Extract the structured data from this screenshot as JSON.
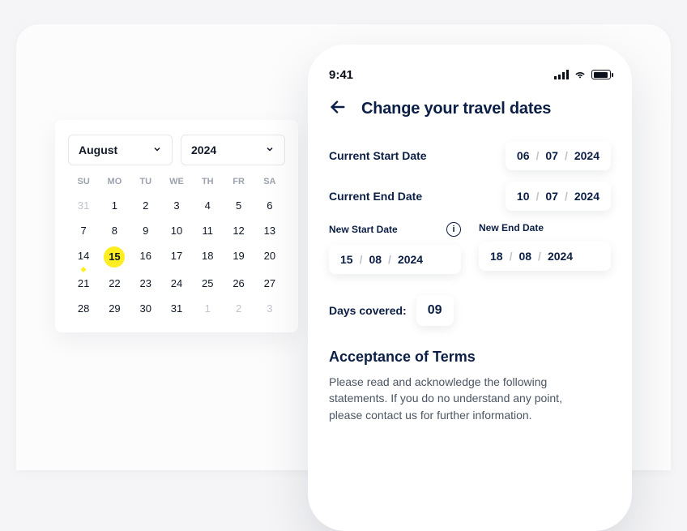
{
  "calendar": {
    "month": "August",
    "year": "2024",
    "weekdays": [
      "SU",
      "MO",
      "TU",
      "WE",
      "TH",
      "FR",
      "SA"
    ],
    "cells": [
      {
        "n": "31",
        "mute": true
      },
      {
        "n": "1"
      },
      {
        "n": "2"
      },
      {
        "n": "3"
      },
      {
        "n": "4"
      },
      {
        "n": "5"
      },
      {
        "n": "6"
      },
      {
        "n": "7"
      },
      {
        "n": "8"
      },
      {
        "n": "9"
      },
      {
        "n": "10"
      },
      {
        "n": "11"
      },
      {
        "n": "12"
      },
      {
        "n": "13"
      },
      {
        "n": "14",
        "dot": true
      },
      {
        "n": "15",
        "sel": true
      },
      {
        "n": "16"
      },
      {
        "n": "17"
      },
      {
        "n": "18"
      },
      {
        "n": "19"
      },
      {
        "n": "20"
      },
      {
        "n": "21"
      },
      {
        "n": "22"
      },
      {
        "n": "23"
      },
      {
        "n": "24"
      },
      {
        "n": "25"
      },
      {
        "n": "26"
      },
      {
        "n": "27"
      },
      {
        "n": "28"
      },
      {
        "n": "29"
      },
      {
        "n": "30"
      },
      {
        "n": "31"
      },
      {
        "n": "1",
        "mute": true
      },
      {
        "n": "2",
        "mute": true
      },
      {
        "n": "3",
        "mute": true
      }
    ]
  },
  "phone": {
    "status": {
      "time": "9:41"
    },
    "header": {
      "title": "Change your travel dates"
    },
    "fields": {
      "current_start": {
        "label": "Current Start Date",
        "dd": "06",
        "mm": "07",
        "yyyy": "2024"
      },
      "current_end": {
        "label": "Current End Date",
        "dd": "10",
        "mm": "07",
        "yyyy": "2024"
      },
      "new_start": {
        "label": "New Start Date",
        "dd": "15",
        "mm": "08",
        "yyyy": "2024"
      },
      "new_end": {
        "label": "New End Date",
        "dd": "18",
        "mm": "08",
        "yyyy": "2024"
      }
    },
    "days_covered": {
      "label": "Days covered:",
      "value": "09"
    },
    "terms": {
      "heading": "Acceptance of Terms",
      "body": "Please read and acknowledge the following statements. If you do no understand any point, please contact us for further information."
    },
    "slash": "/"
  }
}
